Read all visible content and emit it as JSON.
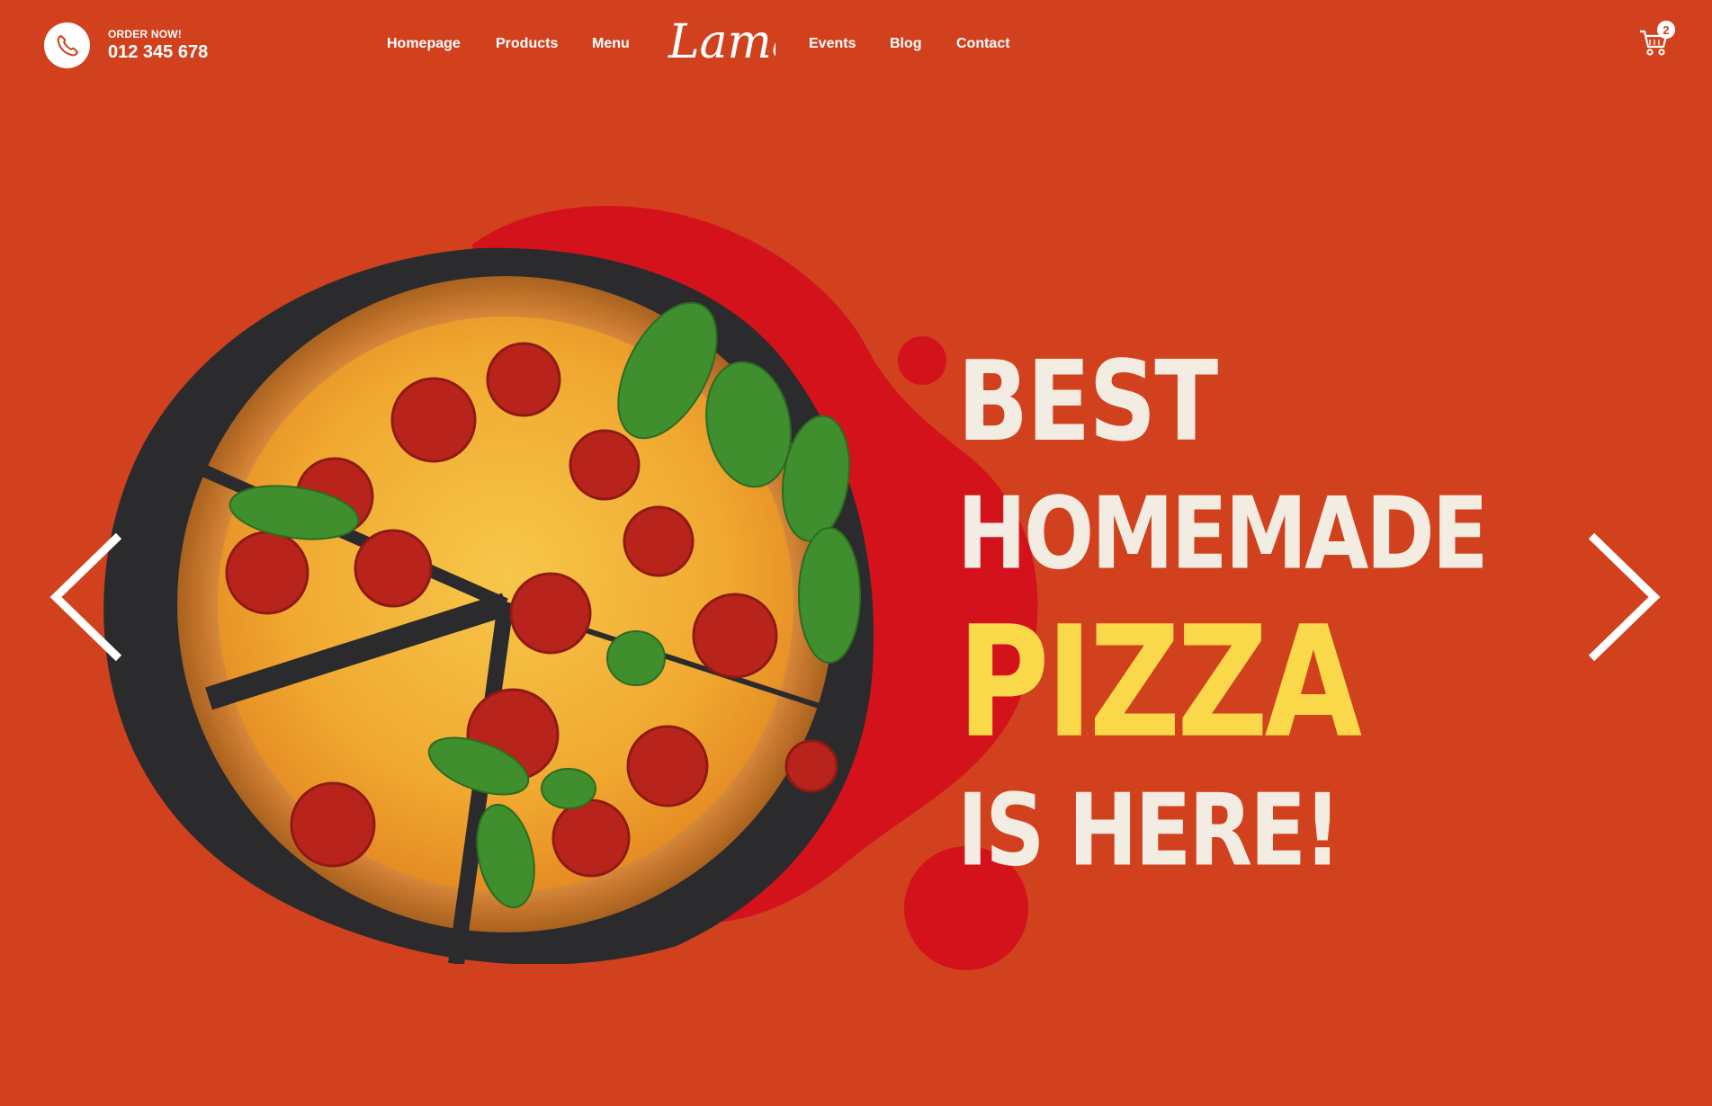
{
  "header": {
    "order_label": "ORDER NOW!",
    "phone": "012 345 678",
    "nav": {
      "homepage": "Homepage",
      "products": "Products",
      "menu": "Menu",
      "events": "Events",
      "blog": "Blog",
      "contact": "Contact"
    },
    "logo_text": "Lama",
    "cart_count": "2"
  },
  "hero": {
    "line1": "BEST",
    "line2": "HOMEMADE",
    "line3": "PIZZA",
    "line4": "IS HERE!"
  },
  "icons": {
    "call": "telephone-icon",
    "cart": "shopping-cart-icon",
    "prev": "chevron-left-icon",
    "next": "chevron-right-icon"
  },
  "colors": {
    "background": "#d1411e",
    "blob": "#d4121b",
    "accent_yellow": "#f9d949",
    "text_light": "#f3ece3"
  }
}
